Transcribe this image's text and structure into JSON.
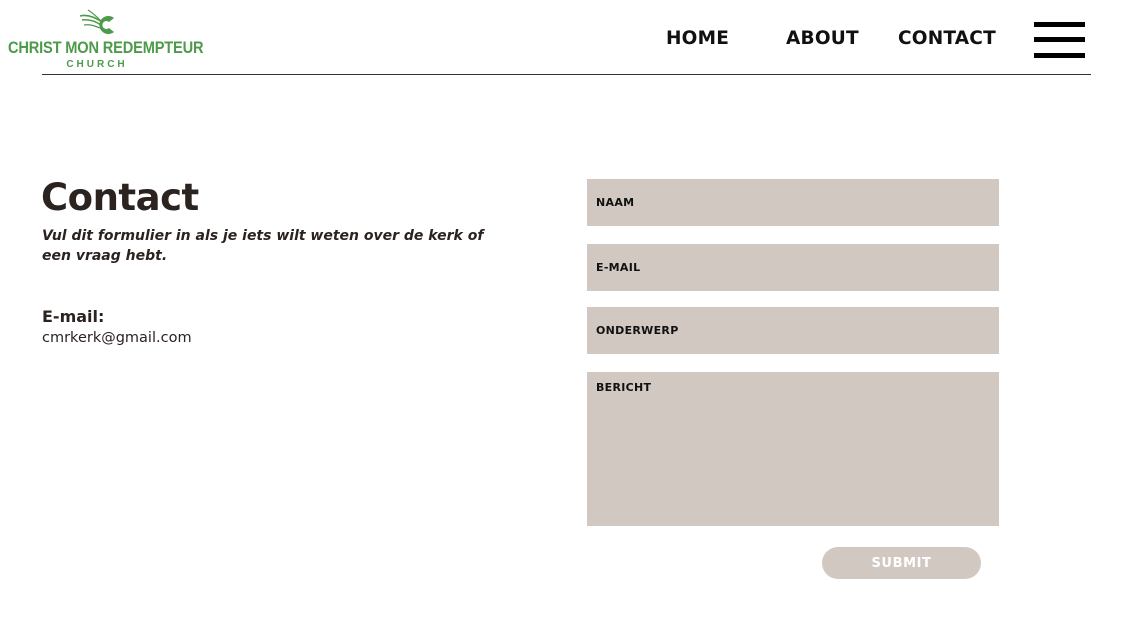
{
  "theme": {
    "brand_color": "#4e9a4b",
    "field_color": "#d2c8c2",
    "text_color": "#2b2320"
  },
  "logo": {
    "name": "CHRIST MON REDEMPTEUR",
    "sub": "CHURCH",
    "icon": "church-c-logo-icon"
  },
  "nav": {
    "home": "HOME",
    "about": "ABOUT",
    "contact": "CONTACT",
    "menu_icon": "hamburger-menu-icon"
  },
  "contact": {
    "title": "Contact",
    "intro": "Vul dit formulier in als je iets wilt weten over de kerk of een vraag hebt.",
    "email_label": "E-mail:",
    "email_value": "cmrkerk@gmail.com"
  },
  "form": {
    "naam": {
      "placeholder": "NAAM",
      "value": ""
    },
    "email": {
      "placeholder": "E-MAIL",
      "value": ""
    },
    "onderwerp": {
      "placeholder": "ONDERWERP",
      "value": ""
    },
    "bericht": {
      "placeholder": "BERICHT",
      "value": ""
    },
    "submit_label": "SUBMIT"
  }
}
